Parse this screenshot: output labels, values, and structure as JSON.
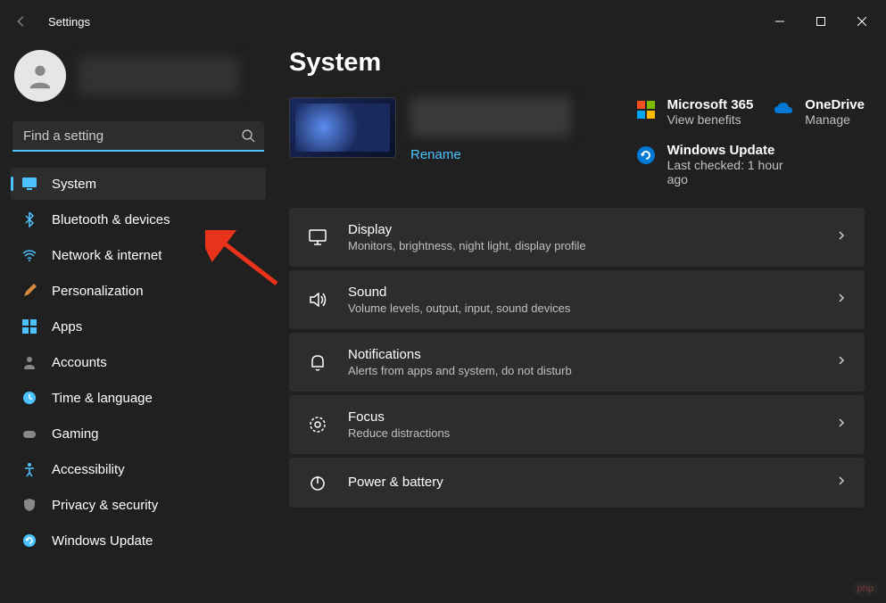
{
  "window": {
    "title": "Settings"
  },
  "search": {
    "placeholder": "Find a setting"
  },
  "nav": {
    "items": [
      {
        "label": "System",
        "icon": "monitor"
      },
      {
        "label": "Bluetooth & devices",
        "icon": "bluetooth"
      },
      {
        "label": "Network & internet",
        "icon": "wifi"
      },
      {
        "label": "Personalization",
        "icon": "brush"
      },
      {
        "label": "Apps",
        "icon": "apps"
      },
      {
        "label": "Accounts",
        "icon": "user"
      },
      {
        "label": "Time & language",
        "icon": "clock"
      },
      {
        "label": "Gaming",
        "icon": "game"
      },
      {
        "label": "Accessibility",
        "icon": "access"
      },
      {
        "label": "Privacy & security",
        "icon": "shield"
      },
      {
        "label": "Windows Update",
        "icon": "update"
      }
    ],
    "active_index": 0
  },
  "page": {
    "title": "System",
    "rename_label": "Rename",
    "services": {
      "m365": {
        "title": "Microsoft 365",
        "sub": "View benefits"
      },
      "onedrive": {
        "title": "OneDrive",
        "sub": "Manage"
      },
      "update": {
        "title": "Windows Update",
        "sub": "Last checked: 1 hour ago"
      }
    },
    "settings": [
      {
        "title": "Display",
        "sub": "Monitors, brightness, night light, display profile",
        "icon": "display"
      },
      {
        "title": "Sound",
        "sub": "Volume levels, output, input, sound devices",
        "icon": "sound"
      },
      {
        "title": "Notifications",
        "sub": "Alerts from apps and system, do not disturb",
        "icon": "bell"
      },
      {
        "title": "Focus",
        "sub": "Reduce distractions",
        "icon": "focus"
      },
      {
        "title": "Power & battery",
        "sub": "",
        "icon": "power"
      }
    ]
  },
  "colors": {
    "accent": "#4cc2ff",
    "bg": "#202020",
    "card": "#2d2d2d"
  }
}
